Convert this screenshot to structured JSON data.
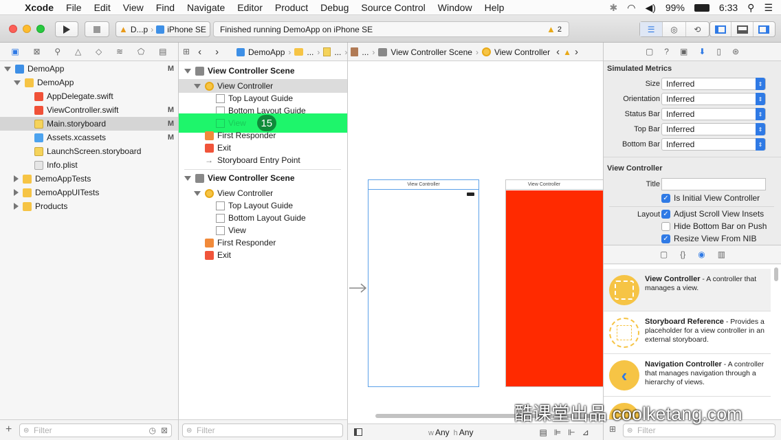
{
  "menubar": {
    "app": "Xcode",
    "items": [
      "File",
      "Edit",
      "View",
      "Find",
      "Navigate",
      "Editor",
      "Product",
      "Debug",
      "Source Control",
      "Window",
      "Help"
    ],
    "battery": "99%",
    "time": "6:33"
  },
  "toolbar": {
    "scheme_name": "D...p",
    "device": "iPhone SE",
    "activity_text": "Finished running DemoApp on iPhone SE",
    "warning_count": "2"
  },
  "navigator": {
    "tree": [
      {
        "label": "DemoApp",
        "flag": "M",
        "icon": "project-icon"
      },
      {
        "label": "DemoApp",
        "flag": "",
        "icon": "folder-icon"
      },
      {
        "label": "AppDelegate.swift",
        "flag": "",
        "icon": "swift-file-icon"
      },
      {
        "label": "ViewController.swift",
        "flag": "M",
        "icon": "swift-file-icon"
      },
      {
        "label": "Main.storyboard",
        "flag": "M",
        "icon": "storyboard-file-icon"
      },
      {
        "label": "Assets.xcassets",
        "flag": "M",
        "icon": "asset-catalog-icon"
      },
      {
        "label": "LaunchScreen.storyboard",
        "flag": "",
        "icon": "storyboard-file-icon"
      },
      {
        "label": "Info.plist",
        "flag": "",
        "icon": "plist-file-icon"
      },
      {
        "label": "DemoAppTests",
        "flag": "",
        "icon": "folder-icon"
      },
      {
        "label": "DemoAppUITests",
        "flag": "",
        "icon": "folder-icon"
      },
      {
        "label": "Products",
        "flag": "",
        "icon": "folder-icon"
      }
    ],
    "filter_placeholder": "Filter"
  },
  "jumpbar": {
    "project": "DemoApp",
    "ellipsis1": "...",
    "ellipsis2": "...",
    "ellipsis3": "...",
    "scene": "View Controller Scene",
    "controller": "View Controller"
  },
  "outline": {
    "scene1": {
      "title": "View Controller Scene",
      "controller": "View Controller",
      "top_guide": "Top Layout Guide",
      "bottom_guide": "Bottom Layout Guide",
      "view": "View",
      "badge": "15",
      "responder": "First Responder",
      "exit": "Exit",
      "entry": "Storyboard Entry Point"
    },
    "scene2": {
      "title": "View Controller Scene",
      "controller": "View Controller",
      "top_guide": "Top Layout Guide",
      "bottom_guide": "Bottom Layout Guide",
      "view": "View",
      "responder": "First Responder",
      "exit": "Exit"
    },
    "filter_placeholder": "Filter"
  },
  "canvas": {
    "vc1_title": "View Controller",
    "vc2_title": "View Controller",
    "vc2_color": "#ff2a00",
    "size_w_prefix": "w",
    "size_w": "Any",
    "size_h_prefix": "h",
    "size_h": "Any"
  },
  "inspector": {
    "simulated_metrics": {
      "heading": "Simulated Metrics",
      "rows": [
        {
          "label": "Size",
          "value": "Inferred"
        },
        {
          "label": "Orientation",
          "value": "Inferred"
        },
        {
          "label": "Status Bar",
          "value": "Inferred"
        },
        {
          "label": "Top Bar",
          "value": "Inferred"
        },
        {
          "label": "Bottom Bar",
          "value": "Inferred"
        }
      ]
    },
    "view_controller": {
      "heading": "View Controller",
      "title_label": "Title",
      "title_value": "",
      "is_initial": "Is Initial View Controller",
      "layout_label": "Layout",
      "adjust_insets": "Adjust Scroll View Insets",
      "hide_bottom_bar": "Hide Bottom Bar on Push",
      "resize_from_nib": "Resize View From NIB"
    },
    "library": [
      {
        "title": "View Controller",
        "desc": " - A controller that manages a view."
      },
      {
        "title": "Storyboard Reference",
        "desc": " - Provides a placeholder for a view controller in an external storyboard."
      },
      {
        "title": "Navigation Controller",
        "desc": " - A controller that manages navigation through a hierarchy of views."
      }
    ],
    "filter_placeholder": "Filter"
  },
  "watermark": "酷课堂出品 coolketang.com"
}
